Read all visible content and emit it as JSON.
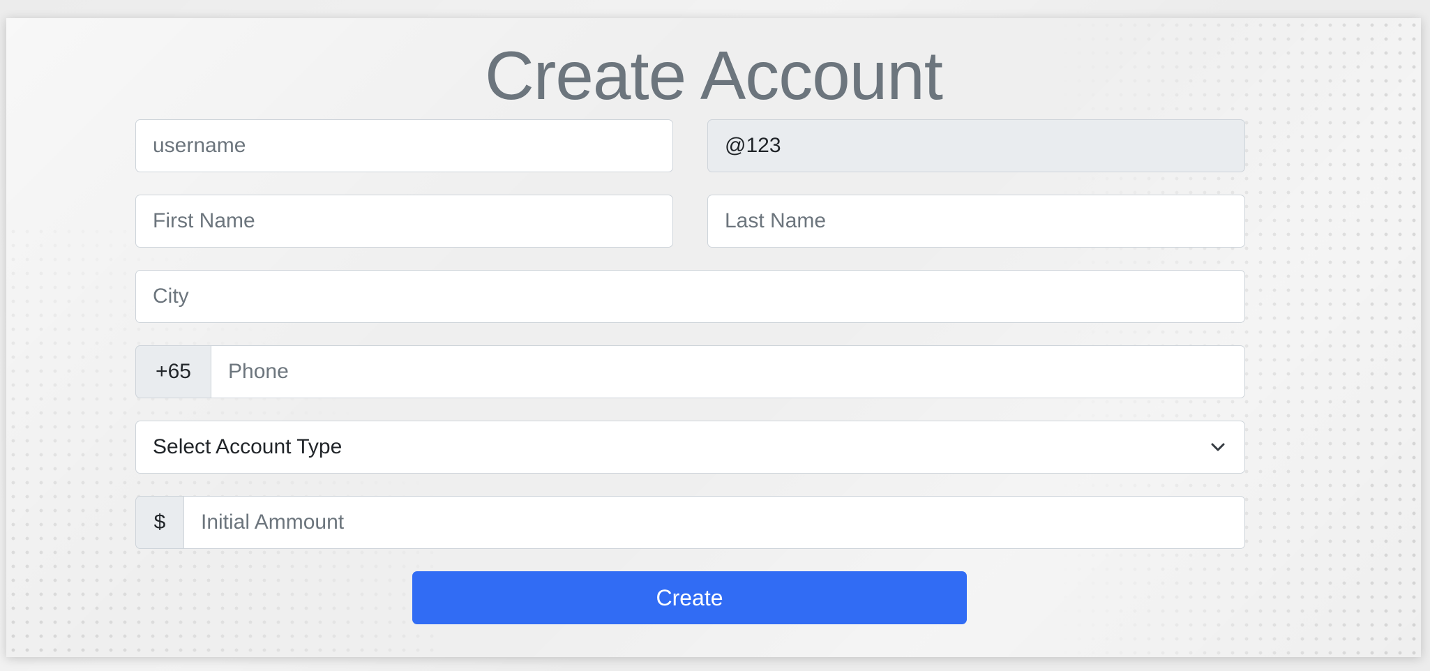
{
  "page": {
    "title": "Create Account"
  },
  "form": {
    "username_placeholder": "username",
    "username_suffix_value": "@123",
    "first_name_placeholder": "First Name",
    "last_name_placeholder": "Last Name",
    "city_placeholder": "City",
    "phone_prefix": "+65",
    "phone_placeholder": "Phone",
    "account_type_selected": "Select Account Type",
    "amount_prefix": "$",
    "amount_placeholder": "Initial Ammount",
    "submit_label": "Create"
  },
  "icons": {
    "select_arrow": "chevron-down-icon"
  },
  "colors": {
    "primary": "#316cf4",
    "title": "#6c757d",
    "placeholder": "#6c757d",
    "disabled_bg": "#e9ecef"
  }
}
